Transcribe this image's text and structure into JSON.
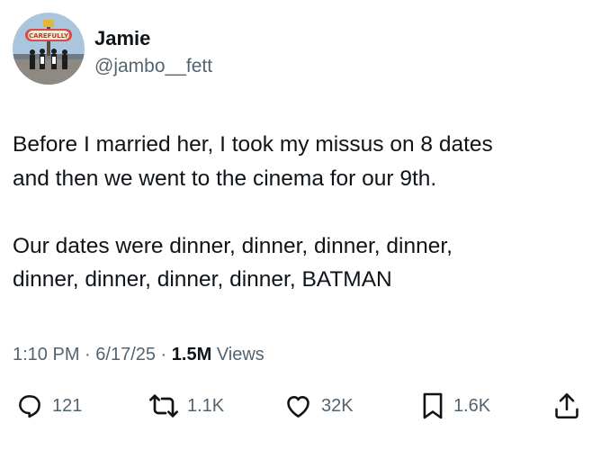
{
  "author": {
    "name": "Jamie",
    "handle": "@jambo__fett",
    "avatar_sign_text": "CAREFULLY"
  },
  "tweet": {
    "lines": [
      "Before I married her, I took my missus on 8 dates",
      "and then we went to the cinema for our 9th.",
      "Our dates were dinner, dinner, dinner, dinner,",
      "dinner, dinner, dinner, dinner, BATMAN"
    ]
  },
  "meta": {
    "time": "1:10 PM",
    "date": "6/17/25",
    "separator": " · ",
    "views_count": "1.5M",
    "views_label": "Views"
  },
  "actions": {
    "replies": "121",
    "reposts": "1.1K",
    "likes": "32K",
    "bookmarks": "1.6K"
  },
  "colors": {
    "text": "#0f1419",
    "secondary": "#536471"
  }
}
